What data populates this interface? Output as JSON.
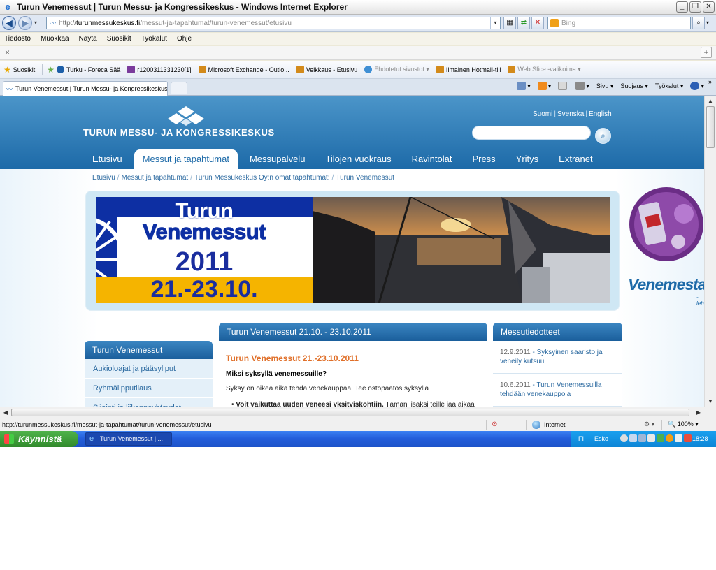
{
  "window": {
    "title": "Turun Venemessut | Turun Messu- ja Kongressikeskus - Windows Internet Explorer",
    "buttons": [
      "_",
      "❐",
      "✕"
    ]
  },
  "address_bar": {
    "url_prefix": "http://",
    "url_domain": "turunmessukeskus.fi",
    "url_path": "/messut-ja-tapahtumat/turun-venemessut/etusivu",
    "search_placeholder": "Bing"
  },
  "menu": [
    "Tiedosto",
    "Muokkaa",
    "Näytä",
    "Suosikit",
    "Työkalut",
    "Ohje"
  ],
  "favorites_bar": {
    "favorites_label": "Suosikit",
    "items": [
      {
        "label": "Turku - Foreca Sää",
        "grey": false,
        "color": "#1d5fa8"
      },
      {
        "label": "r1200311331230[1]",
        "grey": false,
        "color": "#7a3b9c"
      },
      {
        "label": "Microsoft Exchange - Outlo...",
        "grey": false,
        "color": "#d38a1a"
      },
      {
        "label": "Veikkaus - Etusivu",
        "grey": false,
        "color": "#d38a1a"
      },
      {
        "label": "Ehdotetut sivustot ▾",
        "grey": true,
        "color": "#3f8fd4"
      },
      {
        "label": "Ilmainen Hotmail-tili",
        "grey": false,
        "color": "#d38a1a"
      },
      {
        "label": "Web Slice -valikoima ▾",
        "grey": true,
        "color": "#d38a1a"
      }
    ]
  },
  "tabs": {
    "active_tab": "Turun Venemessut | Turun Messu- ja Kongressikeskus",
    "commands": [
      "Sivu ▾",
      "Suojaus ▾",
      "Työkalut ▾"
    ],
    "more": "»"
  },
  "site": {
    "logo_text": "TURUN MESSU- JA KONGRESSIKESKUS",
    "languages": [
      "Suomi",
      "Svenska",
      "English"
    ],
    "nav": [
      "Etusivu",
      "Messut ja tapahtumat",
      "Messupalvelu",
      "Tilojen vuokraus",
      "Ravintolat",
      "Press",
      "Yritys",
      "Extranet"
    ],
    "breadcrumb": [
      "Etusivu",
      "Messut ja tapahtumat",
      "Turun Messukeskus Oy:n omat tapahtumat:",
      "Turun Venemessut"
    ],
    "hero": {
      "line1": "Turun",
      "line2": "Venemessut",
      "line3": "2011",
      "line4": "21.-23.10."
    },
    "ads": {
      "venemestari": "Venemestari",
      "lehti": "-lehti"
    },
    "left_panel": {
      "title": "Turun Venemessut",
      "items": [
        "Aukioloajat ja pääsyliput",
        "Ryhmälipputilaus",
        "Sijainti ja liikenneyhteydet"
      ]
    },
    "content": {
      "header": "Turun Venemessut 21.10. - 23.10.2011",
      "title": "Turun Venemessut 21.-23.10.2011",
      "question": "Miksi syksyllä venemessuille?",
      "paragraph": "Syksy on oikea aika tehdä venekauppaa. Tee ostopäätös syksyllä",
      "bullet_bold": "Voit vaikuttaa uuden veneesi yksityiskohtiin.",
      "bullet_rest": " Tämän lisäksi teille jää aikaa"
    },
    "news_panel": {
      "title": "Messutiedotteet",
      "items": [
        {
          "date": "12.9.2011",
          "text": "Syksyinen saaristo ja veneily kutsuu"
        },
        {
          "date": "10.6.2011",
          "text": "Turun Venemessuilla tehdään venekauppoja"
        }
      ]
    }
  },
  "status_bar": {
    "url": "http://turunmessukeskus.fi/messut-ja-tapahtumat/turun-venemessut/etusivu",
    "zone": "Internet",
    "zoom": "100%"
  },
  "taskbar": {
    "start": "Käynnistä",
    "task": "Turun Venemessut | ...",
    "lang": "FI",
    "user": "Esko",
    "time": "18:28"
  }
}
